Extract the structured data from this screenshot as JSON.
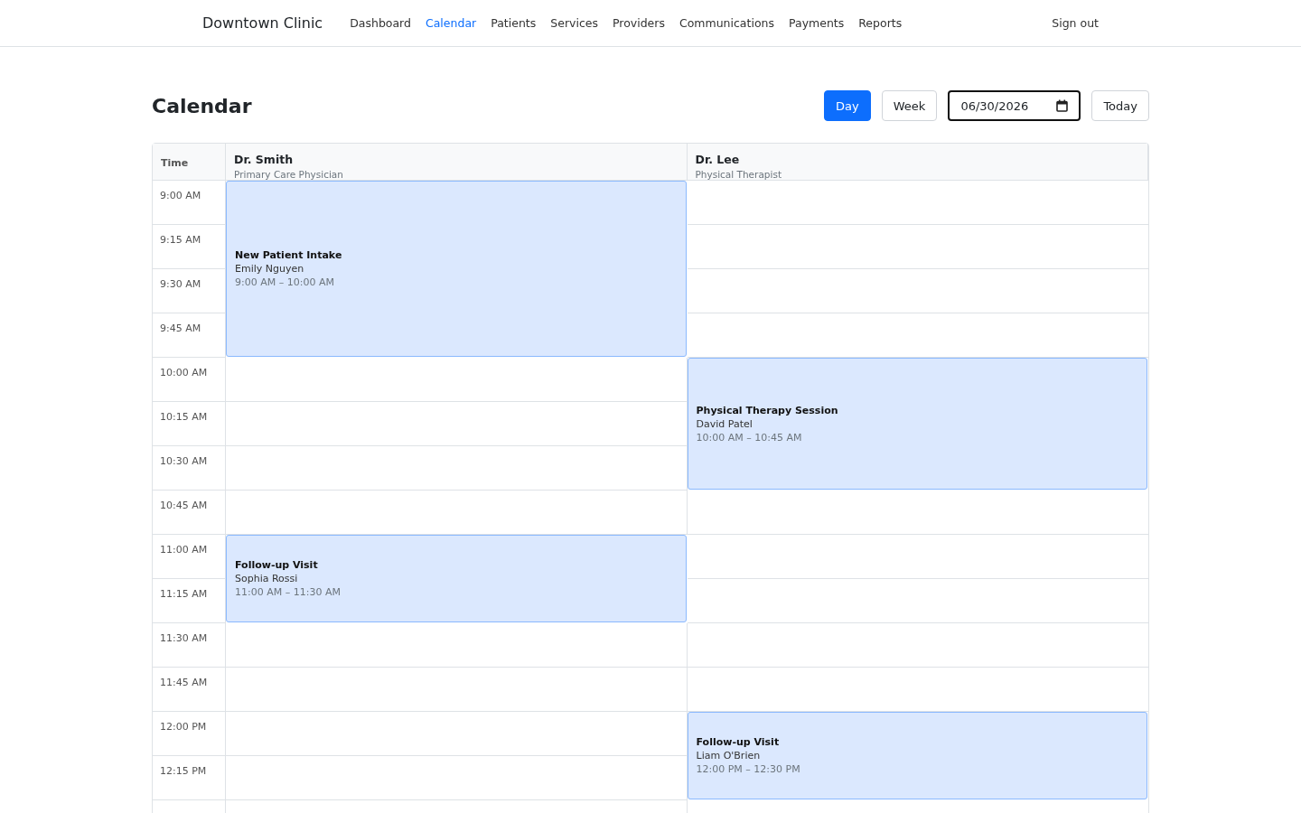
{
  "brand": "Downtown Clinic",
  "nav": [
    {
      "label": "Dashboard",
      "selected": false
    },
    {
      "label": "Calendar",
      "selected": true
    },
    {
      "label": "Patients",
      "selected": false
    },
    {
      "label": "Services",
      "selected": false
    },
    {
      "label": "Providers",
      "selected": false
    },
    {
      "label": "Communications",
      "selected": false
    },
    {
      "label": "Payments",
      "selected": false
    },
    {
      "label": "Reports",
      "selected": false
    }
  ],
  "sign_out": "Sign out",
  "page_title": "Calendar",
  "view_buttons": [
    {
      "label": "Day",
      "selected": true
    },
    {
      "label": "Week",
      "selected": false
    }
  ],
  "date_field": {
    "value": "06/30/2026"
  },
  "today_button": "Today",
  "calendar": {
    "time_heading": "Time",
    "times": [
      "9:00 AM",
      "9:15 AM",
      "9:30 AM",
      "9:45 AM",
      "10:00 AM",
      "10:15 AM",
      "10:30 AM",
      "10:45 AM",
      "11:00 AM",
      "11:15 AM",
      "11:30 AM",
      "11:45 AM",
      "12:00 PM",
      "12:15 PM"
    ],
    "providers": [
      {
        "name": "Dr. Smith",
        "role": "Primary Care Physician",
        "blocks": [
          {
            "kind": "appointment",
            "title": "New Patient Intake",
            "patient": "Emily Nguyen",
            "time": "9:00 AM – 10:00 AM"
          },
          {
            "kind": "covered"
          },
          {
            "kind": "covered"
          },
          {
            "kind": "covered"
          },
          {
            "kind": "slot"
          },
          {
            "kind": "slot"
          },
          {
            "kind": "slot"
          },
          {
            "kind": "slot"
          },
          {
            "kind": "appointment",
            "title": "Follow-up Visit",
            "patient": "Sophia Rossi",
            "time": "11:00 AM – 11:30 AM"
          },
          {
            "kind": "covered"
          },
          {
            "kind": "slot"
          },
          {
            "kind": "slot"
          },
          {
            "kind": "slot"
          },
          {
            "kind": "slot"
          }
        ]
      },
      {
        "name": "Dr. Lee",
        "role": "Physical Therapist",
        "blocks": [
          {
            "kind": "slot"
          },
          {
            "kind": "slot"
          },
          {
            "kind": "slot"
          },
          {
            "kind": "slot"
          },
          {
            "kind": "appointment",
            "title": "Physical Therapy Session",
            "patient": "David Patel",
            "time": "10:00 AM – 10:45 AM"
          },
          {
            "kind": "covered"
          },
          {
            "kind": "covered"
          },
          {
            "kind": "slot"
          },
          {
            "kind": "slot"
          },
          {
            "kind": "slot"
          },
          {
            "kind": "slot"
          },
          {
            "kind": "slot"
          },
          {
            "kind": "appointment",
            "title": "Follow-up Visit",
            "patient": "Liam O'Brien",
            "time": "12:00 PM – 12:30 PM"
          },
          {
            "kind": "covered"
          }
        ]
      }
    ]
  }
}
